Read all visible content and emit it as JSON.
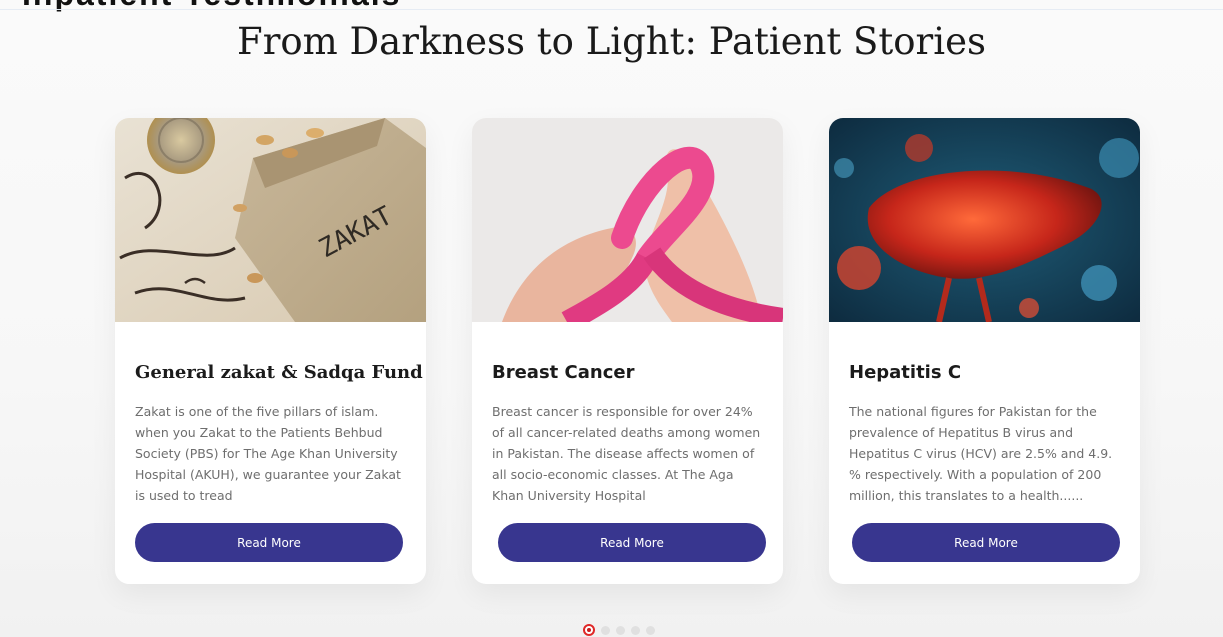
{
  "header": {
    "partial_heading": "Inpatient Testimonials",
    "title": "From Darkness to Light: Patient Stories"
  },
  "cards": [
    {
      "title": "General zakat & Sadqa Fund",
      "text": "Zakat is one of the five pillars of islam. when you  Zakat to the Patients Behbud Society (PBS) for The Age Khan University Hospital (AKUH), we guarantee your Zakat is used to tread",
      "image_word": "ZAKAT",
      "button_label": "Read More"
    },
    {
      "title": "Breast Cancer",
      "text": "Breast cancer is responsible for over 24% of all cancer-related deaths among women in Pakistan. The disease affects women of all socio-economic classes. At The Aga Khan University Hospital",
      "button_label": "Read More"
    },
    {
      "title": "Hepatitis C",
      "text": "The national figures for Pakistan for the prevalence of Hepatitus B virus and Hepatitus C virus (HCV) are 2.5% and 4.9. % respectively. With a population of 200 million, this translates to a health......",
      "button_label": "Read More"
    }
  ],
  "carousel": {
    "total_dots": 5,
    "active_index": 0
  },
  "colors": {
    "button": "#38368f",
    "active_dot": "#e02828"
  }
}
